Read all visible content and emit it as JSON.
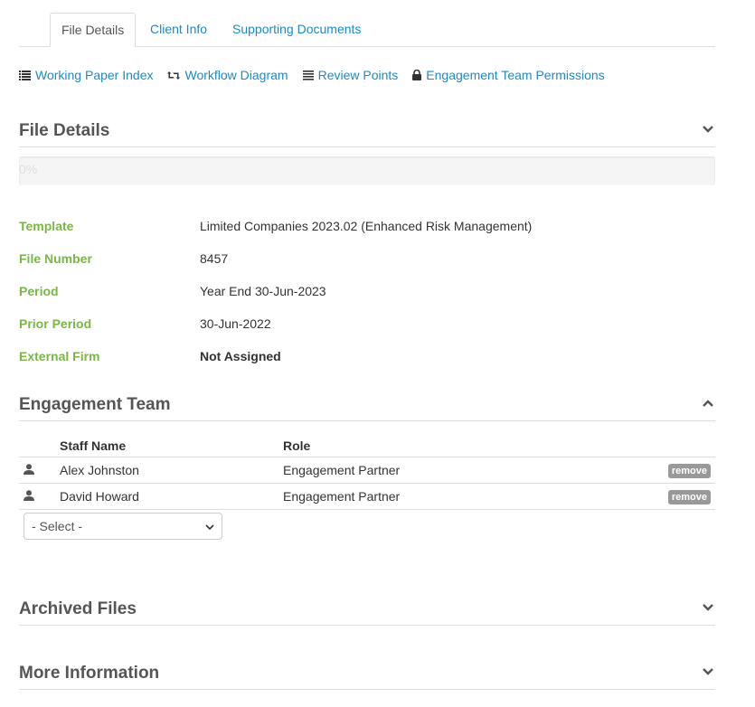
{
  "tabs": [
    {
      "label": "File Details"
    },
    {
      "label": "Client Info"
    },
    {
      "label": "Supporting Documents"
    }
  ],
  "toolbar": {
    "working_paper_index": "Working Paper Index",
    "workflow_diagram": "Workflow Diagram",
    "review_points": "Review Points",
    "engagement_team_permissions": "Engagement Team Permissions"
  },
  "file_details": {
    "title": "File Details",
    "progress_text": "0%",
    "progress_value": 0,
    "fields": [
      {
        "label": "Template",
        "value": "Limited Companies 2023.02 (Enhanced Risk Management)"
      },
      {
        "label": "File Number",
        "value": "8457"
      },
      {
        "label": "Period",
        "value": "Year End 30-Jun-2023"
      },
      {
        "label": "Prior Period",
        "value": "30-Jun-2022"
      },
      {
        "label": "External Firm",
        "value": "Not Assigned"
      }
    ]
  },
  "engagement_team": {
    "title": "Engagement Team",
    "columns": {
      "staff_name": "Staff Name",
      "role": "Role"
    },
    "rows": [
      {
        "name": "Alex Johnston",
        "role": "Engagement Partner",
        "action": "remove"
      },
      {
        "name": "David Howard",
        "role": "Engagement Partner",
        "action": "remove"
      }
    ],
    "select_value": "- Select -"
  },
  "archived_files": {
    "title": "Archived Files"
  },
  "more_information": {
    "title": "More Information"
  },
  "colors": {
    "link": "#1a8bc8",
    "label_green": "#7ab648",
    "heading": "#555555"
  }
}
